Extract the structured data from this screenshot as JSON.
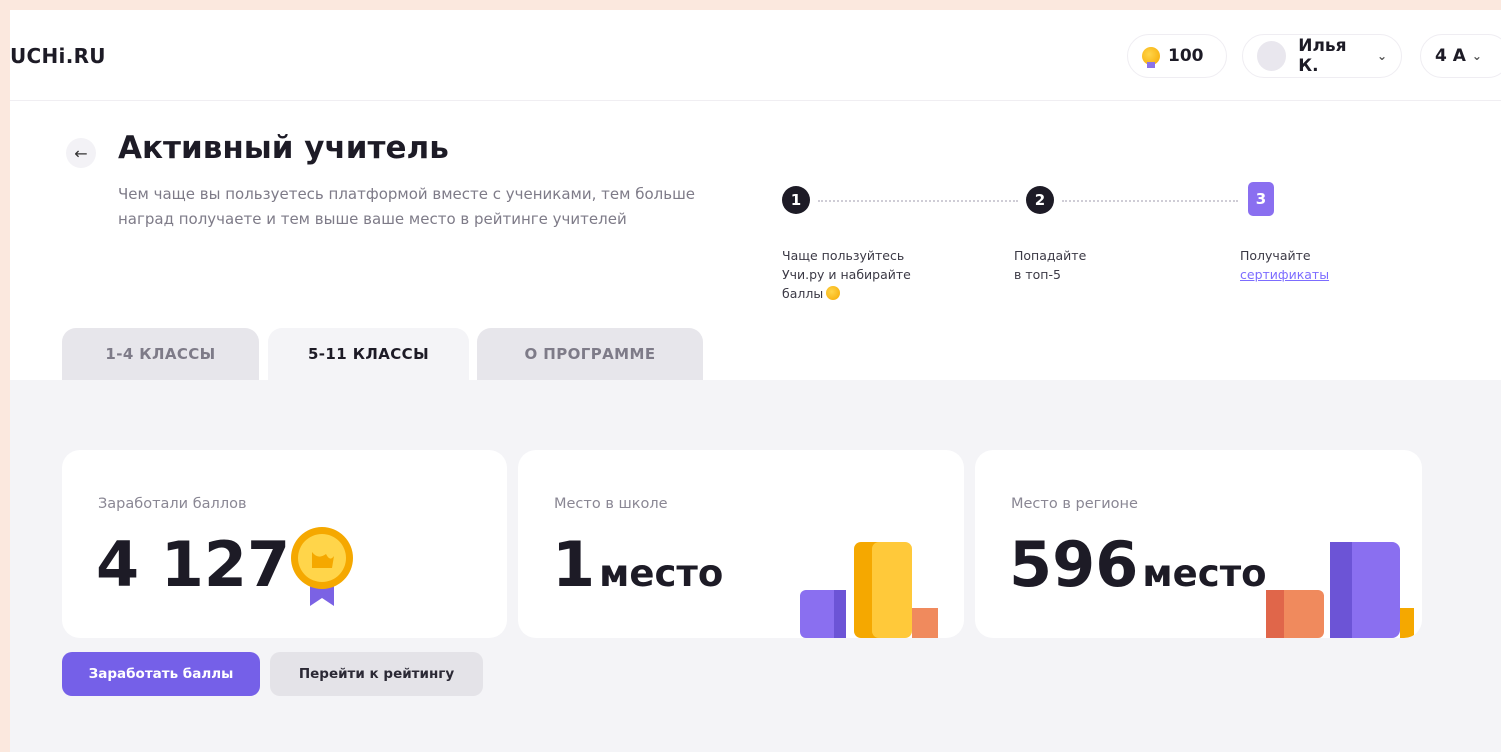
{
  "header": {
    "logo": "UCHi.RU",
    "points": "100",
    "user_name": "Илья К.",
    "grade": "4 А"
  },
  "page": {
    "title": "Активный учитель",
    "subtitle": "Чем чаще вы пользуетесь платформой вместе с учениками, тем больше наград получаете и тем выше ваше место в рейтинге учителей"
  },
  "steps": [
    {
      "num": "1",
      "line1": "Чаще пользуйтесь",
      "line2": "Учи.ру и набирайте",
      "line3": "баллы"
    },
    {
      "num": "2",
      "line1": "Попадайте",
      "line2": "в топ-5"
    },
    {
      "num": "3",
      "line1": "Получайте",
      "link": "сертификаты"
    }
  ],
  "tabs": [
    {
      "label": "1-4 КЛАССЫ",
      "active": false
    },
    {
      "label": "5-11 КЛАССЫ",
      "active": true
    },
    {
      "label": "О ПРОГРАММЕ",
      "active": false
    }
  ],
  "cards": [
    {
      "label": "Заработали баллов",
      "value": "4 127",
      "unit": ""
    },
    {
      "label": "Место в школе",
      "value": "1",
      "unit": "место"
    },
    {
      "label": "Место в регионе",
      "value": "596",
      "unit": "место"
    }
  ],
  "buttons": {
    "earn": "Заработать баллы",
    "rating": "Перейти к рейтингу"
  },
  "colors": {
    "accent": "#7560e8",
    "gold": "#f5a800",
    "coral": "#f08a5d",
    "violet": "#8a6ff0"
  },
  "icons": [
    "back-arrow-icon",
    "coin-icon",
    "avatar-icon",
    "chevron-down-icon",
    "medal-icon"
  ]
}
